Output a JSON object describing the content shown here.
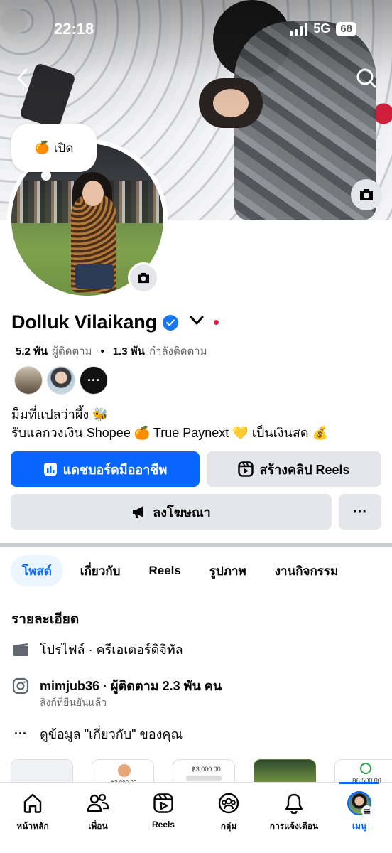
{
  "status_bar": {
    "time": "22:18",
    "network": "5G",
    "battery": "68"
  },
  "note": {
    "emoji": "🍊",
    "text": "เปิด"
  },
  "profile": {
    "name": "Dolluk Vilaikang",
    "followers_count": "5.2 พัน",
    "followers_label": "ผู้ติดตาม",
    "following_count": "1.3 พัน",
    "following_label": "กำลังติดตาม",
    "friends_more": "···",
    "bio_line1": "ม็มที่แปลว่าผึ้ง 🐝",
    "bio_line2": "รับแลกวงเงิน Shopee 🍊 True Paynext 💛 เป็นเงินสด 💰"
  },
  "buttons": {
    "dashboard": "แดชบอร์ดมืออาชีพ",
    "create_reels": "สร้างคลิป Reels",
    "advertise": "ลงโฆษณา",
    "more": "···"
  },
  "tabs": [
    {
      "label": "โพสต์",
      "active": true
    },
    {
      "label": "เกี่ยวกับ",
      "active": false
    },
    {
      "label": "Reels",
      "active": false
    },
    {
      "label": "รูปภาพ",
      "active": false
    },
    {
      "label": "งานกิจกรรม",
      "active": false
    }
  ],
  "details": {
    "title": "รายละเอียด",
    "category": "โปรไฟล์ · ครีเอเตอร์ดิจิทัล",
    "instagram": "mimjub36 · ผู้ติดตาม 2.3 พัน คน",
    "instagram_sub": "ลิงก์ที่ยืนยันแล้ว",
    "see_about": "ดูข้อมูล \"เกี่ยวกับ\" ของคุณ"
  },
  "featured": {
    "t2_amount": "฿3,000.00",
    "t3_amount": "฿3,000.00",
    "t5_amount": "฿6,500.00"
  },
  "bottom_nav": [
    {
      "label": "หน้าหลัก",
      "icon": "home-icon"
    },
    {
      "label": "เพื่อน",
      "icon": "friends-icon"
    },
    {
      "label": "Reels",
      "icon": "reels-icon"
    },
    {
      "label": "กลุ่ม",
      "icon": "groups-icon"
    },
    {
      "label": "การแจ้งเตือน",
      "icon": "bell-icon"
    },
    {
      "label": "เมนู",
      "icon": "menu-avatar",
      "active": true
    }
  ],
  "colors": {
    "accent": "#0866ff",
    "verified": "#1877f2",
    "secondary_button": "#e4e6eb"
  }
}
